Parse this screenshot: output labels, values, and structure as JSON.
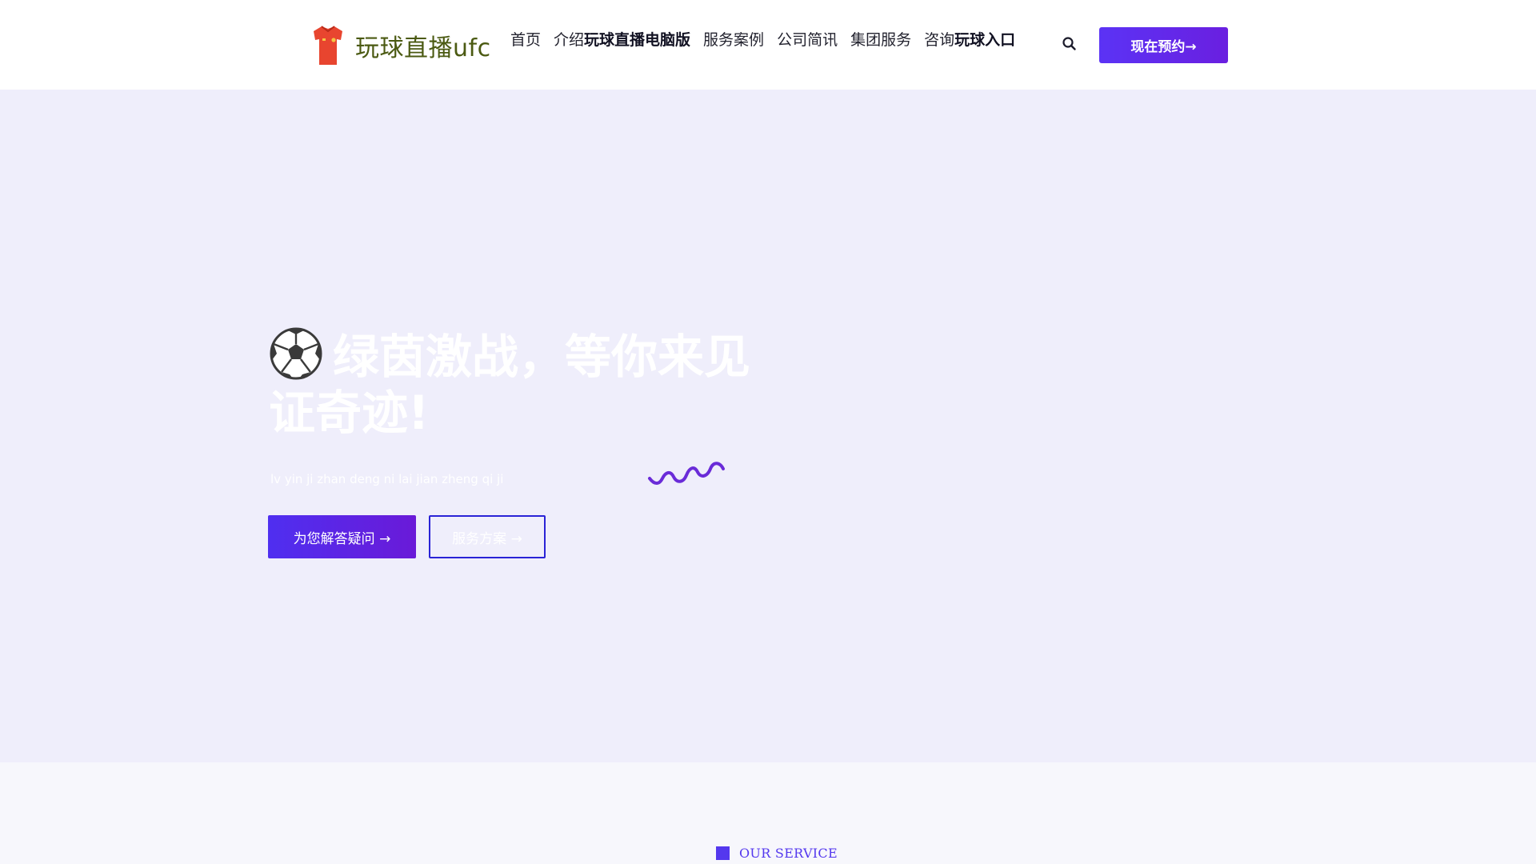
{
  "header": {
    "logo_text": "玩球直播ufc",
    "nav": [
      {
        "pre": "首页",
        "bold": ""
      },
      {
        "pre": "介绍",
        "bold": "玩球直播电脑版"
      },
      {
        "pre": "服务案例",
        "bold": ""
      },
      {
        "pre": "公司简讯",
        "bold": ""
      },
      {
        "pre": "集团服务",
        "bold": ""
      },
      {
        "pre": "咨询",
        "bold": "玩球入口"
      }
    ],
    "cta_label": "现在预约→",
    "icons": {
      "logo": "jersey-icon",
      "search": "search-icon"
    }
  },
  "hero": {
    "title": "绿茵激战，等你来见证奇迹!",
    "title_icon": "soccer-ball-icon",
    "subtitle": "lv yin ji zhan deng ni lai jian zheng qi ji",
    "primary_button": "为您解答疑问 →",
    "secondary_button": "服务方案 →"
  },
  "service_section": {
    "tag": "OUR SERVICE"
  },
  "colors": {
    "accent": "#5b33f5",
    "accent_dark": "#6a1fe0",
    "hero_bg": "#efeefb",
    "logo_text": "#4b5a12",
    "jersey": "#e8452f",
    "squiggle": "#6a2bd8",
    "outline_border": "#2a23d6"
  }
}
